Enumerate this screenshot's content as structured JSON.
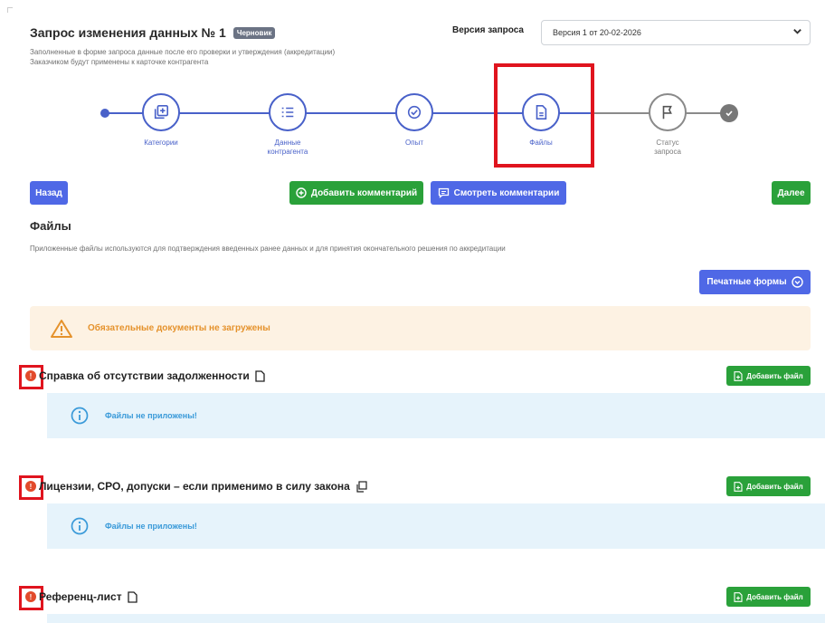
{
  "header": {
    "title": "Запрос изменения данных № 1",
    "status_badge": "Черновик",
    "subtitle_line1": "Заполненные в форме запроса данные после его проверки и утверждения (аккредитации)",
    "subtitle_line2": "Заказчиком будут применены к карточке контрагента",
    "version_label": "Версия запроса",
    "version_value": "Версия 1 от 20-02-2026"
  },
  "stepper": {
    "steps": [
      {
        "label": "Категории",
        "icon": "add-copy-icon",
        "state": "done"
      },
      {
        "label": "Данные\nконтрагента",
        "icon": "list-icon",
        "state": "done"
      },
      {
        "label": "Опыт",
        "icon": "check-circle-icon",
        "state": "done"
      },
      {
        "label": "Файлы",
        "icon": "document-icon",
        "state": "current"
      },
      {
        "label": "Статус\nзапроса",
        "icon": "flag-icon",
        "state": "pending"
      }
    ]
  },
  "actions": {
    "back_label": "Назад",
    "add_comment_label": "Добавить комментарий",
    "view_comments_label": "Смотреть комментарии",
    "next_label": "Далее"
  },
  "files": {
    "title": "Файлы",
    "description": "Приложенные файлы используются для подтверждения введенных ранее данных и для принятия окончательного решения по аккредитации",
    "print_forms_label": "Печатные формы",
    "warning": "Обязательные документы не загружены",
    "add_file_label": "Добавить файл",
    "no_files_text": "Файлы не приложены!",
    "documents": [
      {
        "title": "Справка об отсутствии задолженности",
        "icon": "file-icon"
      },
      {
        "title": "Лицензии, СРО, допуски – если применимо в силу закона",
        "icon": "copy-icon"
      },
      {
        "title": "Референц-лист",
        "icon": "file-icon"
      }
    ]
  },
  "colors": {
    "primary": "#4f68e6",
    "success": "#2aa13a",
    "warning_bg": "#fdf2e3",
    "warning_text": "#e5922c",
    "info_bg": "#e6f3fb",
    "info_text": "#3a9ad9",
    "error": "#e24b2c",
    "highlight": "#e0141e"
  }
}
